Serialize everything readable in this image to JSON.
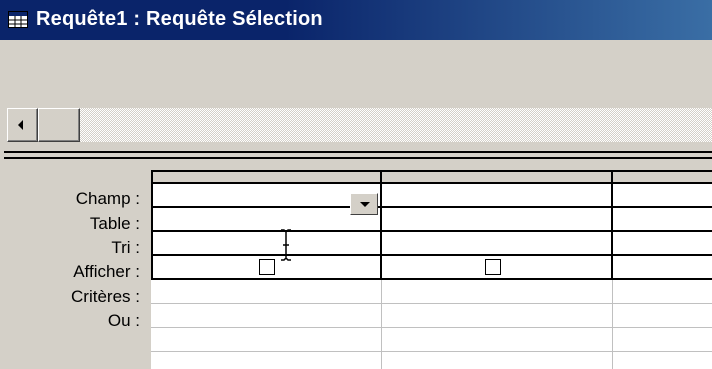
{
  "window": {
    "title": "Requête1 : Requête Sélection",
    "title_icon": "query-icon"
  },
  "table_pane": {
    "scroll_left_icon": "arrow-left-icon"
  },
  "grid": {
    "row_labels": [
      "Champ :",
      "Table :",
      "Tri :",
      "Afficher :",
      "Critères :",
      "Ou :"
    ],
    "columns": [
      {
        "champ": "",
        "table": "",
        "tri": "",
        "afficher": false,
        "criteres": "",
        "ou": ""
      },
      {
        "champ": "",
        "table": "",
        "tri": "",
        "afficher": false,
        "criteres": "",
        "ou": ""
      },
      {
        "champ": "",
        "table": "",
        "tri": "",
        "afficher": false,
        "criteres": "",
        "ou": ""
      }
    ],
    "dropdown_icon": "dropdown-arrow-icon",
    "cursor_icon": "text-cursor-icon"
  },
  "colors": {
    "titlebar": "#0a246a",
    "window_face": "#d4d0c8",
    "grid_background": "#ffffff"
  }
}
